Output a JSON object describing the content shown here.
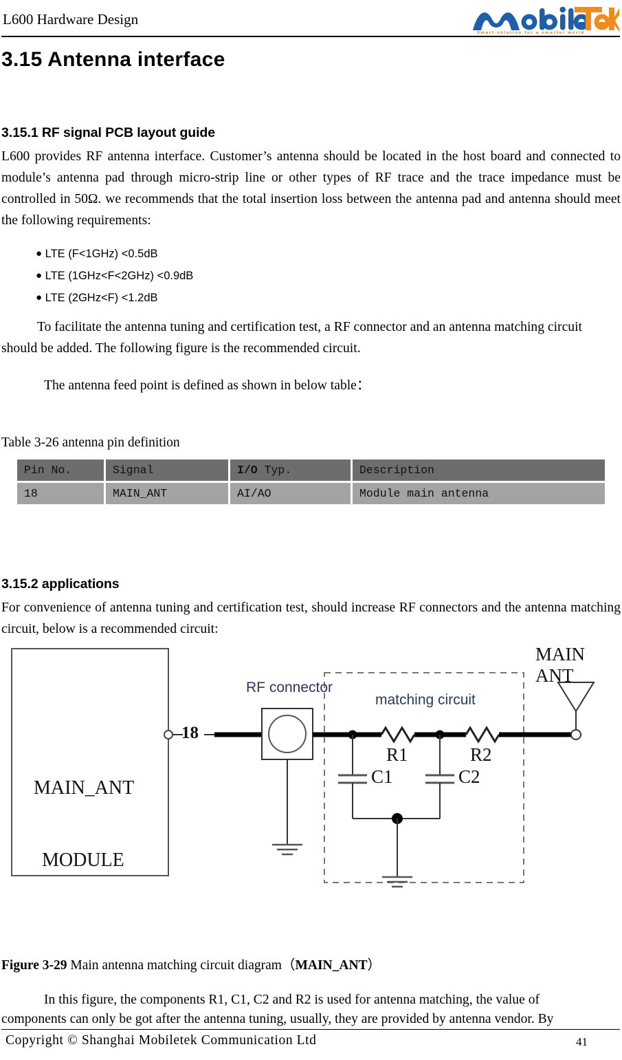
{
  "header": {
    "doc_title": "L600 Hardware Design",
    "logo": {
      "name": "MobileTek",
      "part_blue": "obile",
      "part_orange": "Tek",
      "tagline": "Smart solution for a smarter world",
      "blue": "#1F5FA9",
      "orange": "#F08C1E"
    }
  },
  "section": {
    "title": "3.15 Antenna interface",
    "sub1": {
      "title": "3.15.1 RF signal PCB layout guide",
      "paragraph": "L600 provides RF antenna interface. Customer’s antenna should be located in the host board and connected to module’s antenna pad through micro-strip line or other types of RF trace and the trace impedance must be controlled in 50Ω. we recommends that the total insertion loss between the antenna pad and antenna should meet the following requirements:",
      "bullets": [
        "LTE (F<1GHz) <0.5dB",
        "LTE (1GHz<F<2GHz) <0.9dB",
        "LTE (2GHz<F) <1.2dB"
      ],
      "bullet_symbol": "●",
      "paragraph2": "To facilitate the antenna tuning and certification test, a RF connector and an antenna matching circuit should be added. The following figure is the recommended circuit.",
      "paragraph3": "The antenna feed point is defined as shown in below table："
    },
    "sub2": {
      "title": "3.15.2 applications",
      "paragraph": "For convenience of antenna tuning and certification test, should increase RF connectors and the antenna matching circuit, below is a recommended circuit:",
      "paragraph_after_figure_line1": "In this figure, the components R1, C1, C2 and R2 is used for antenna matching, the value of",
      "paragraph_after_figure_line2": "components can only be got after the antenna tuning, usually, they are provided by antenna vendor. By"
    }
  },
  "table": {
    "caption": "Table 3-26 antenna pin definition",
    "headers": [
      "Pin No.",
      "Signal",
      "I/O Typ.",
      "Description"
    ],
    "header_io_bold": "I/O",
    "header_io_rest": " Typ.",
    "rows": [
      [
        "18",
        "MAIN_ANT",
        "AI/AO",
        "Module main antenna"
      ]
    ],
    "header_bg": "#6d6d6d",
    "row_bg": "#a3a3a3"
  },
  "figure": {
    "caption_label": "Figure 3-29",
    "caption_text": " Main antenna matching circuit diagram（",
    "caption_bold_tail": "MAIN_ANT",
    "caption_close": "）",
    "labels": {
      "module": "MODULE",
      "pin_signal": "MAIN_ANT",
      "pin_number": "18",
      "rf_connector": "RF connector",
      "matching_circuit": "matching circuit",
      "r1": "R1",
      "r2": "R2",
      "c1": "C1",
      "c2": "C2",
      "main_ant": "MAIN ANT"
    }
  },
  "footer": {
    "copyright": "Copyright © Shanghai Mobiletek Communication Ltd",
    "page_number": "41"
  }
}
